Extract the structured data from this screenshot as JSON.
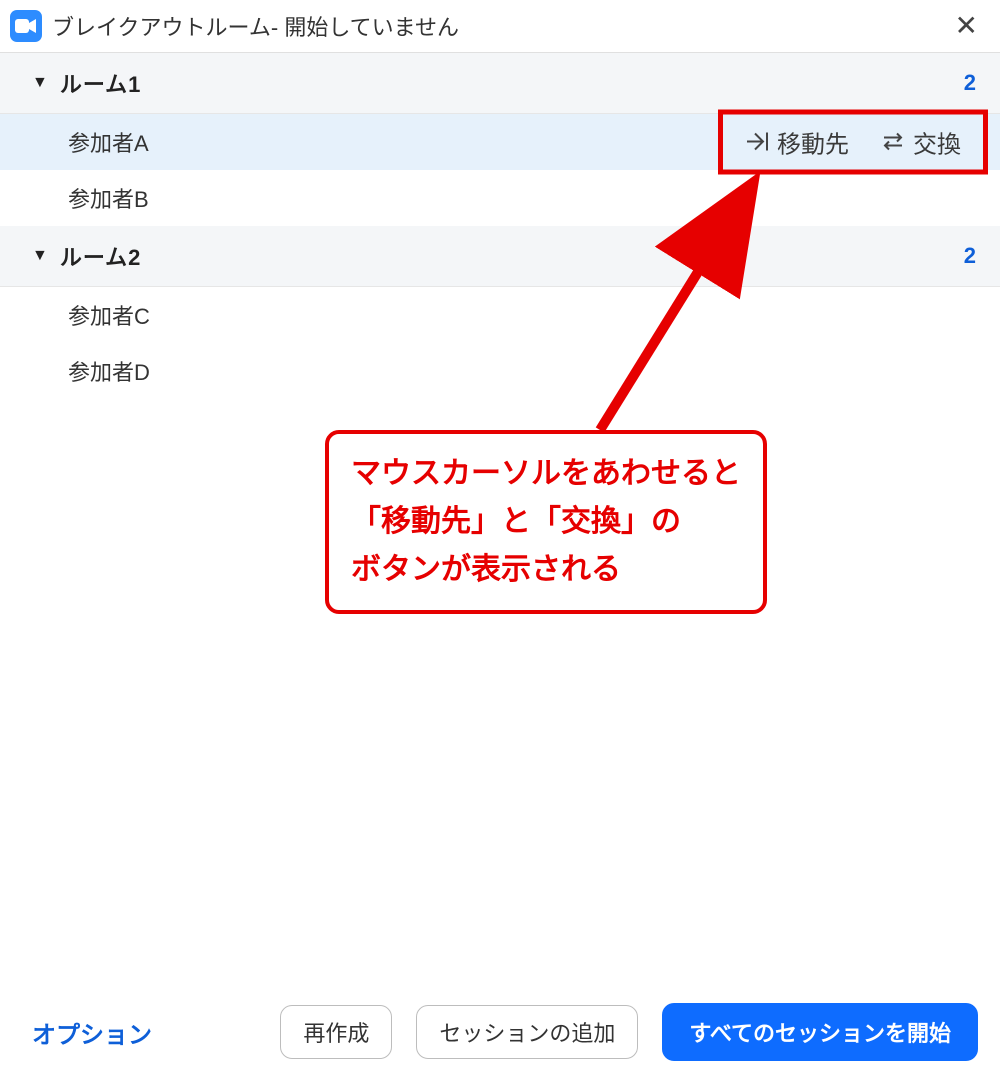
{
  "titlebar": {
    "title": "ブレイクアウトルーム- 開始していません"
  },
  "rooms": [
    {
      "name": "ルーム1",
      "count": "2",
      "participants": [
        "参加者A",
        "参加者B"
      ]
    },
    {
      "name": "ルーム2",
      "count": "2",
      "participants": [
        "参加者C",
        "参加者D"
      ]
    }
  ],
  "hover_actions": {
    "move_to": "移動先",
    "exchange": "交換"
  },
  "annotation": {
    "line1": "マウスカーソルをあわせると",
    "line2": "「移動先」と「交換」の",
    "line3": "ボタンが表示される"
  },
  "footer": {
    "options": "オプション",
    "recreate": "再作成",
    "add_session": "セッションの追加",
    "start_all": "すべてのセッションを開始"
  }
}
